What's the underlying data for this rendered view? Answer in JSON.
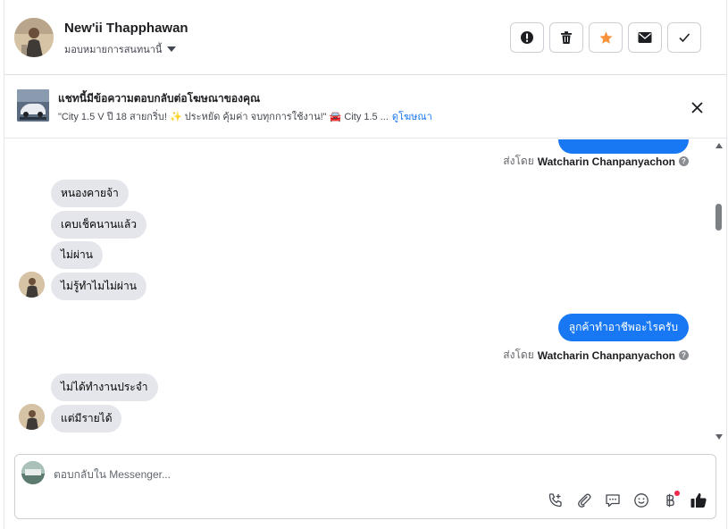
{
  "header": {
    "contact_name": "New'ii Thapphawan",
    "assign_label": "มอบหมายการสนทนานี้",
    "actions": [
      {
        "icon": "alert-icon",
        "name": "mark-spam-button"
      },
      {
        "icon": "trash-icon",
        "name": "delete-button"
      },
      {
        "icon": "star-icon",
        "name": "star-button"
      },
      {
        "icon": "envelope-icon",
        "name": "mark-unread-button"
      },
      {
        "icon": "check-icon",
        "name": "mark-done-button"
      }
    ]
  },
  "ad_banner": {
    "title": "แชทนี้มีข้อความตอบกลับต่อโฆษณาของคุณ",
    "snippet": "\"City 1.5 V ปี 18 สายกริ่บ! ✨ ประหยัด คุ้มค่า จบทุกการใช้งาน!\" 🚘 City 1.5 ...",
    "view_ad_link": "ดูโฆษณา"
  },
  "messages": {
    "sent_by_prefix": "ส่งโดย",
    "agent_name": "Watcharin Chanpanyachon",
    "group1": [
      "หนองคายจ้า",
      "เคบเช็คนานแล้ว",
      "ไม่ผ่าน",
      "ไม่รู้ทำไมไม่ผ่าน"
    ],
    "outgoing1": "ลูกค้าทำอาชีพอะไรครับ",
    "group2": [
      "ไม่ได้ทำงานประจำ",
      "แต่มีรายได้"
    ]
  },
  "composer": {
    "placeholder": "ตอบกลับใน Messenger...",
    "tools": [
      "phone-plus-icon",
      "paperclip-icon",
      "quick-reply-icon",
      "emoji-icon",
      "baht-payment-icon",
      "thumbs-up-icon"
    ]
  },
  "colors": {
    "accent": "#1877f2",
    "incoming_bubble": "#e4e6eb",
    "star": "#f7923a",
    "notification_dot": "#f02849"
  }
}
